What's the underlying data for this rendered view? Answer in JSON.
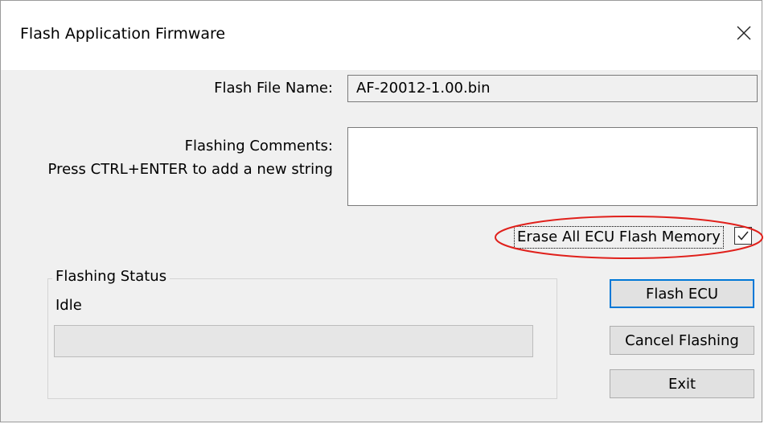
{
  "window": {
    "title": "Flash Application Firmware"
  },
  "form": {
    "file_name_label": "Flash File Name:",
    "file_name_value": "AF-20012-1.00.bin",
    "comments_label_line1": "Flashing Comments:",
    "comments_label_line2": "Press CTRL+ENTER to add a new string",
    "comments_value": "",
    "erase_label": "Erase All ECU Flash Memory",
    "erase_checked": true
  },
  "status": {
    "group_title": "Flashing Status",
    "state": "Idle",
    "progress": 0
  },
  "buttons": {
    "flash": "Flash ECU",
    "cancel": "Cancel Flashing",
    "exit": "Exit"
  },
  "colors": {
    "annotation": "#e0201b",
    "default_button_border": "#0078d7",
    "dialog_background": "#f0f0f0"
  },
  "icons": {
    "close": "close-icon",
    "checkmark": "checkmark-icon"
  }
}
